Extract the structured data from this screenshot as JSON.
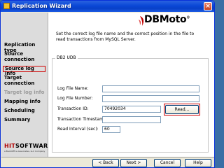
{
  "window": {
    "title": "Replication Wizard",
    "close_symbol": "×"
  },
  "sidebar": {
    "items": [
      {
        "label": "Replication type",
        "state": "normal"
      },
      {
        "label": "Source",
        "state": "normal"
      },
      {
        "label": "connection",
        "state": "normal"
      },
      {
        "label": "Source log info",
        "state": "active"
      },
      {
        "label": "Target",
        "state": "normal"
      },
      {
        "label": "connection",
        "state": "normal"
      },
      {
        "label": "Target log info",
        "state": "disabled"
      },
      {
        "label": "Mapping info",
        "state": "normal"
      },
      {
        "label": "Scheduling",
        "state": "normal"
      },
      {
        "label": "Summary",
        "state": "normal"
      }
    ],
    "brand": {
      "hit": "HIT",
      "software": "SOFTWARE",
      "tagline": "a BackOffice Associates, LLC Company"
    }
  },
  "header": {
    "logo_text": "DBMoto",
    "logo_mark": "®",
    "description": "Set the correct log file name and the correct position in the file to read transactions from MySQL Server."
  },
  "group": {
    "title": "DB2 UDB",
    "fields": {
      "log_file_name": {
        "label": "Log File Name:",
        "value": ""
      },
      "log_file_number": {
        "label": "Log File Number:",
        "value": ""
      },
      "transaction_id": {
        "label": "Transaction ID:",
        "value": "70492034"
      },
      "transaction_timestamp": {
        "label": "Transaction Timestamp:",
        "value": ""
      },
      "read_interval": {
        "label": "Read Interval (sec):",
        "value": "60"
      }
    },
    "read_button": "Read..."
  },
  "footer": {
    "back": "< Back",
    "next": "Next >",
    "cancel": "Cancel",
    "help": "Help"
  },
  "colors": {
    "titlebar": "#0a47d6",
    "highlight": "#d00000",
    "brand_red": "#b00000"
  }
}
